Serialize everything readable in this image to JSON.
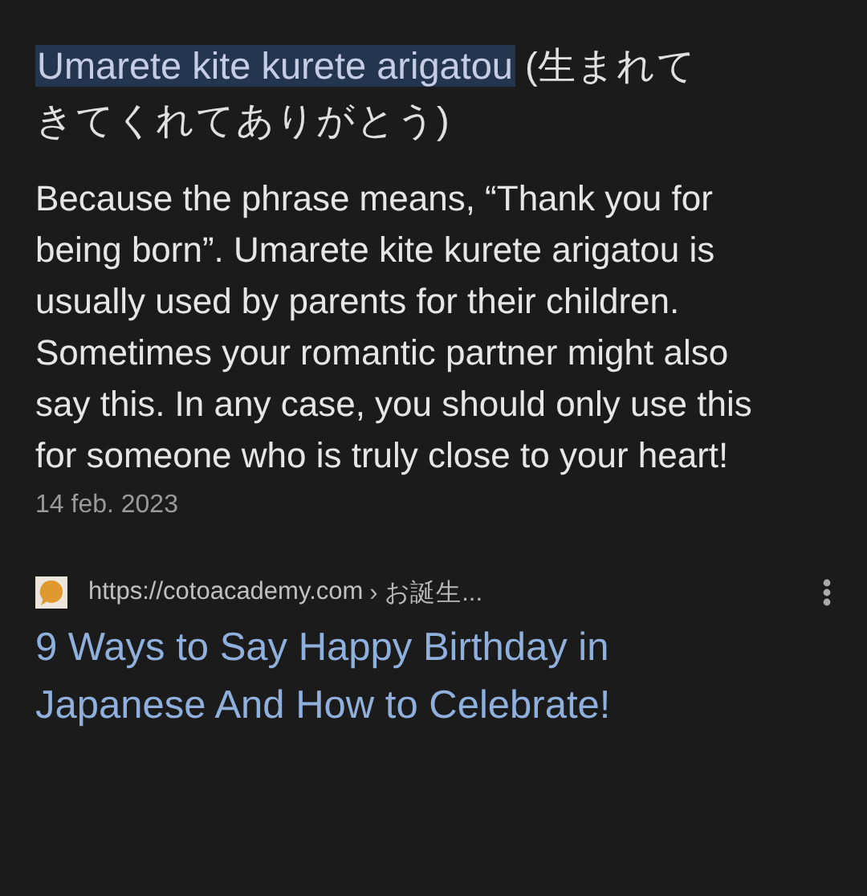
{
  "featured_snippet": {
    "heading_highlight": "Umarete kite kurete arigatou",
    "heading_rest_lines": [
      "(生まれて",
      "きてくれてありがとう)"
    ],
    "body": "Because the phrase means, “Thank you for being born”. Umarete kite kurete arigatou is usually used by parents for their children. Sometimes your romantic partner might also say this. In any case, you should only use this for someone who is truly close to your heart!",
    "date": "14 feb. 2023",
    "source": {
      "url": "https://cotoacademy.com",
      "breadcrumb": "› お誕生...",
      "title": "9 Ways to Say Happy Birthday in Japanese And How to Celebrate!"
    }
  }
}
